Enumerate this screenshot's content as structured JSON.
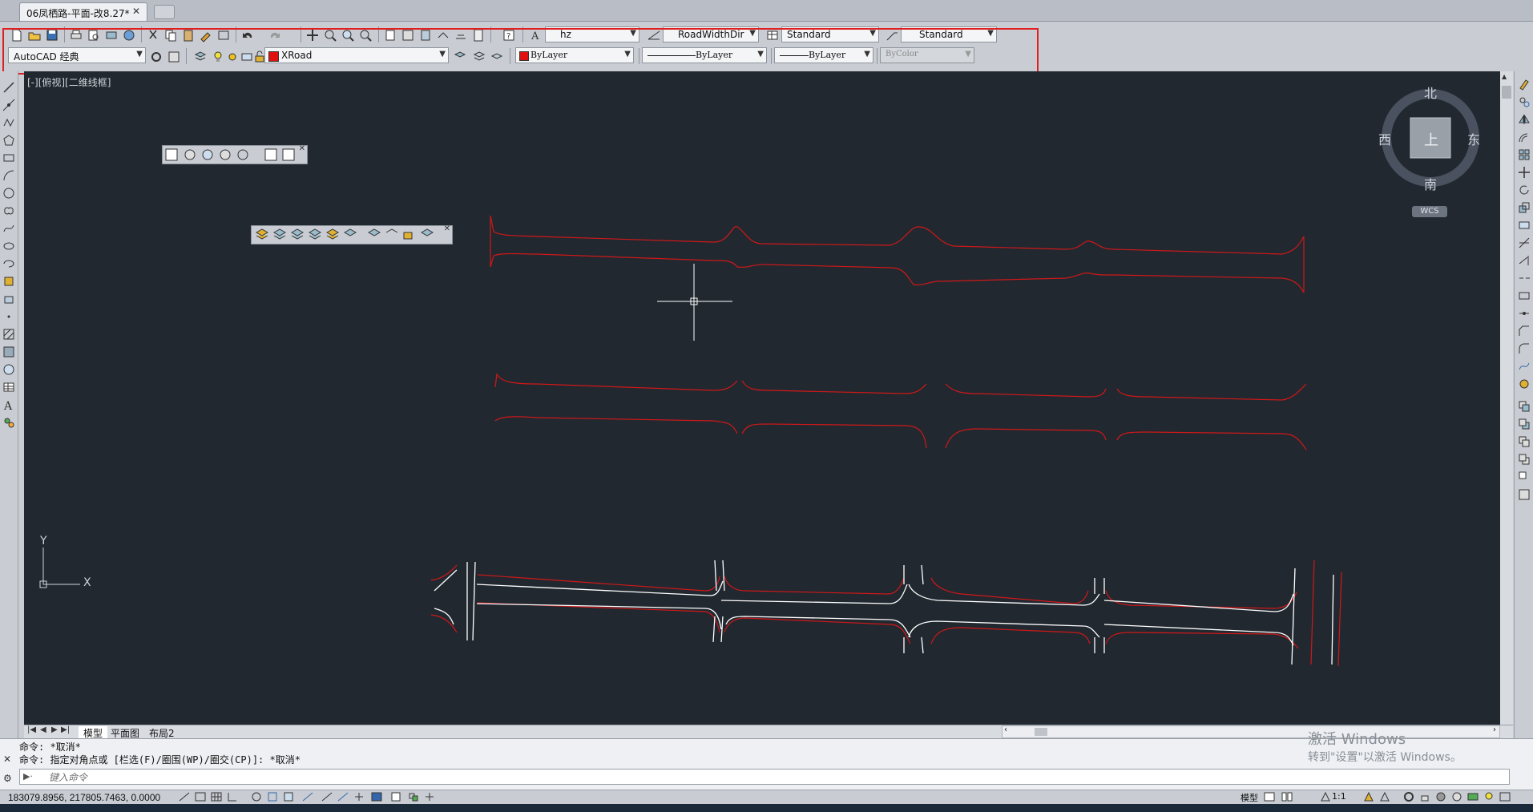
{
  "document": {
    "tab_title": "06凤栖路-平面-改8.27*",
    "tab_close": "✕"
  },
  "toolbar": {
    "text_style": "hz",
    "dim_style": "RoadWidthDir",
    "table_style": "Standard",
    "multileader_style": "Standard",
    "workspace": "AutoCAD 经典",
    "layer": "XRoad",
    "layer_color": "#e01010",
    "color": "ByLayer",
    "linetype": "ByLayer",
    "lineweight": "ByLayer",
    "plotstyle": "ByColor"
  },
  "viewport": {
    "label": "[-][俯视][二维线框]"
  },
  "viewcube": {
    "north": "北",
    "south": "南",
    "east": "东",
    "west": "西",
    "top": "上",
    "wcs": "WCS"
  },
  "ucs": {
    "y": "Y",
    "x": "X"
  },
  "layout_tabs": [
    "模型",
    "平面图",
    "布局2"
  ],
  "watermark": {
    "line1": "激活 Windows",
    "line2": "转到\"设置\"以激活 Windows。"
  },
  "command": {
    "history": [
      "命令: *取消*",
      "命令: 指定对角点或 [栏选(F)/圈围(WP)/圈交(CP)]: *取消*"
    ],
    "placeholder": "键入命令"
  },
  "status": {
    "coordinates": "183079.8956, 217805.7463, 0.0000",
    "model": "模型",
    "scale": "1:1"
  },
  "colors": {
    "canvas": "#212830",
    "road_red": "#d01818",
    "road_white": "#ffffff",
    "highlight": "#e02020"
  }
}
